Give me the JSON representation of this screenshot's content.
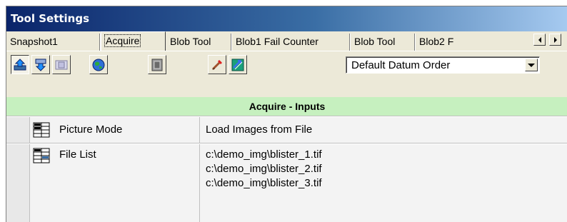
{
  "window": {
    "title": "Tool Settings"
  },
  "tabs": [
    {
      "label": "Snapshot1"
    },
    {
      "label": "Acquire",
      "active": true
    },
    {
      "label": "Blob Tool"
    },
    {
      "label": "Blob1 Fail Counter"
    },
    {
      "label": "Blob Tool"
    },
    {
      "label": "Blob2 F"
    }
  ],
  "toolbar": {
    "buttons": [
      {
        "icon": "move-up-icon",
        "pressed": true
      },
      {
        "icon": "move-down-icon"
      },
      {
        "icon": "rename-icon"
      },
      {
        "icon": "globe-icon"
      },
      {
        "icon": "display-icon"
      },
      {
        "icon": "edit-brush-icon"
      },
      {
        "icon": "datum-arrows-icon"
      }
    ],
    "datum_select": {
      "value": "Default Datum Order"
    }
  },
  "section": {
    "title": "Acquire - Inputs"
  },
  "properties": [
    {
      "name": "Picture Mode",
      "icon": "property-grid-icon",
      "value": "Load Images from File"
    },
    {
      "name": "File List",
      "icon": "property-grid-icon",
      "values": [
        "c:\\demo_img\\blister_1.tif",
        "c:\\demo_img\\blister_2.tif",
        "c:\\demo_img\\blister_3.tif"
      ]
    }
  ],
  "colors": {
    "title_bar_start": "#0a246a",
    "title_bar_end": "#a6caf0",
    "section_header": "#c6f0bf",
    "chrome": "#ece9d8"
  }
}
